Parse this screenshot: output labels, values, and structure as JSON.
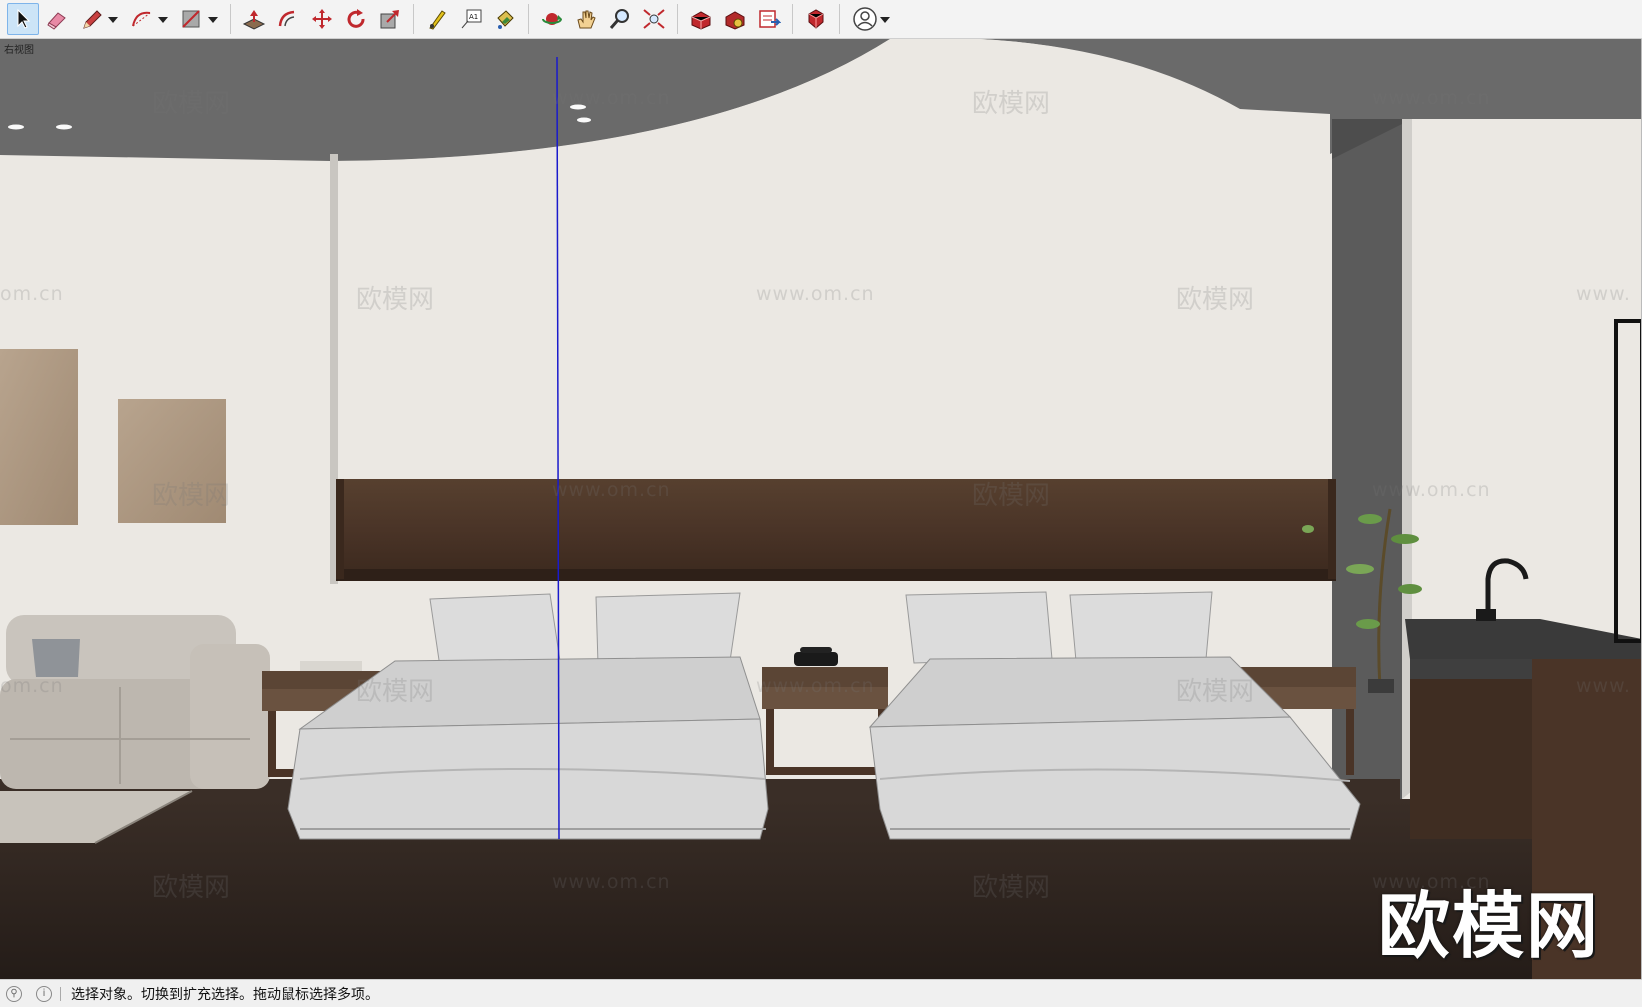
{
  "toolbar": {
    "tools": [
      {
        "name": "select-tool-button",
        "icon": "arrow-cursor-icon",
        "active": true
      },
      {
        "name": "eraser-tool-button",
        "icon": "eraser-icon"
      },
      {
        "name": "line-tool-button",
        "icon": "pencil-icon",
        "dropdown": true
      },
      {
        "name": "arc-tool-button",
        "icon": "arc-icon",
        "dropdown": true
      },
      {
        "name": "rectangle-tool-button",
        "icon": "rectangle-icon",
        "dropdown": true
      },
      {
        "name": "push-pull-tool-button",
        "icon": "push-pull-icon"
      },
      {
        "name": "offset-tool-button",
        "icon": "offset-icon"
      },
      {
        "name": "move-tool-button",
        "icon": "move-icon"
      },
      {
        "name": "rotate-tool-button",
        "icon": "rotate-icon"
      },
      {
        "name": "scale-tool-button",
        "icon": "scale-icon"
      },
      {
        "name": "tape-measure-tool-button",
        "icon": "tape-measure-icon"
      },
      {
        "name": "text-tool-button",
        "icon": "text-label-icon"
      },
      {
        "name": "paint-bucket-tool-button",
        "icon": "paint-bucket-icon"
      },
      {
        "name": "orbit-tool-button",
        "icon": "orbit-icon"
      },
      {
        "name": "pan-tool-button",
        "icon": "hand-icon"
      },
      {
        "name": "zoom-tool-button",
        "icon": "magnifier-icon"
      },
      {
        "name": "zoom-extents-button",
        "icon": "zoom-extents-icon"
      },
      {
        "name": "3d-warehouse-button",
        "icon": "warehouse-icon"
      },
      {
        "name": "extension-warehouse-button",
        "icon": "extension-icon"
      },
      {
        "name": "send-to-layout-button",
        "icon": "layout-icon"
      },
      {
        "name": "extension-manager-button",
        "icon": "ruby-icon"
      },
      {
        "name": "account-button",
        "icon": "user-icon",
        "dropdown": true
      }
    ]
  },
  "viewport": {
    "scene_label": "右视图",
    "watermark_brand": "欧模网",
    "watermark_url": "www.om.cn",
    "watermark_url_left": "om.cn",
    "watermark_url_right": "www.",
    "brand_mark": "欧模网",
    "colors": {
      "ceiling": "#6a6a6a",
      "wall": "#ebe8e3",
      "floor": "#2d231e",
      "headboard_panel": "#4a3427",
      "bedding": "#d9d9d9",
      "axis_line": "#1a1acc"
    }
  },
  "status": {
    "text": "选择对象。切换到扩充选择。拖动鼠标选择多项。"
  }
}
